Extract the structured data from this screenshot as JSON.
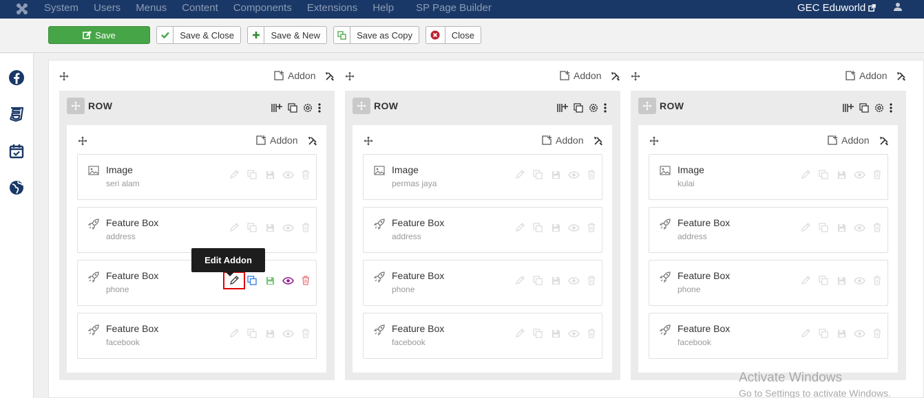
{
  "navbar": {
    "menu": [
      "System",
      "Users",
      "Menus",
      "Content",
      "Components",
      "Extensions",
      "Help"
    ],
    "extra": "SP Page Builder",
    "site": "GEC Eduworld"
  },
  "toolbar": {
    "save": "Save",
    "save_close": "Save & Close",
    "save_new": "Save & New",
    "save_copy": "Save as Copy",
    "close": "Close"
  },
  "builder": {
    "add_addon": "Addon",
    "row_label": "ROW",
    "tooltip": "Edit Addon",
    "columns": [
      {
        "addons": [
          {
            "type": "image",
            "title": "Image",
            "subtitle": "seri alam"
          },
          {
            "type": "feature",
            "title": "Feature Box",
            "subtitle": "address"
          },
          {
            "type": "feature",
            "title": "Feature Box",
            "subtitle": "phone"
          },
          {
            "type": "feature",
            "title": "Feature Box",
            "subtitle": "facebook"
          }
        ]
      },
      {
        "addons": [
          {
            "type": "image",
            "title": "Image",
            "subtitle": "permas jaya"
          },
          {
            "type": "feature",
            "title": "Feature Box",
            "subtitle": "address"
          },
          {
            "type": "feature",
            "title": "Feature Box",
            "subtitle": "phone"
          },
          {
            "type": "feature",
            "title": "Feature Box",
            "subtitle": "facebook"
          }
        ]
      },
      {
        "addons": [
          {
            "type": "image",
            "title": "Image",
            "subtitle": "kulai"
          },
          {
            "type": "feature",
            "title": "Feature Box",
            "subtitle": "address"
          },
          {
            "type": "feature",
            "title": "Feature Box",
            "subtitle": "phone"
          },
          {
            "type": "feature",
            "title": "Feature Box",
            "subtitle": "facebook"
          }
        ]
      }
    ]
  },
  "watermark": {
    "line1": "Activate Windows",
    "line2": "Go to Settings to activate Windows."
  },
  "icons": {
    "sidebar": [
      "facebook-icon",
      "css3-icon",
      "calendar-check-icon",
      "globe-icon"
    ],
    "addon_actions": [
      "pencil-icon",
      "copy-icon",
      "save-icon",
      "eye-icon",
      "trash-icon"
    ]
  },
  "colors": {
    "navbar": "#1a3867",
    "save_green": "#46a546",
    "highlight_red": "#e00000",
    "edit_blue": "#2b7be5",
    "eye_purple": "#8e1b8e",
    "trash_red": "#e57373"
  }
}
